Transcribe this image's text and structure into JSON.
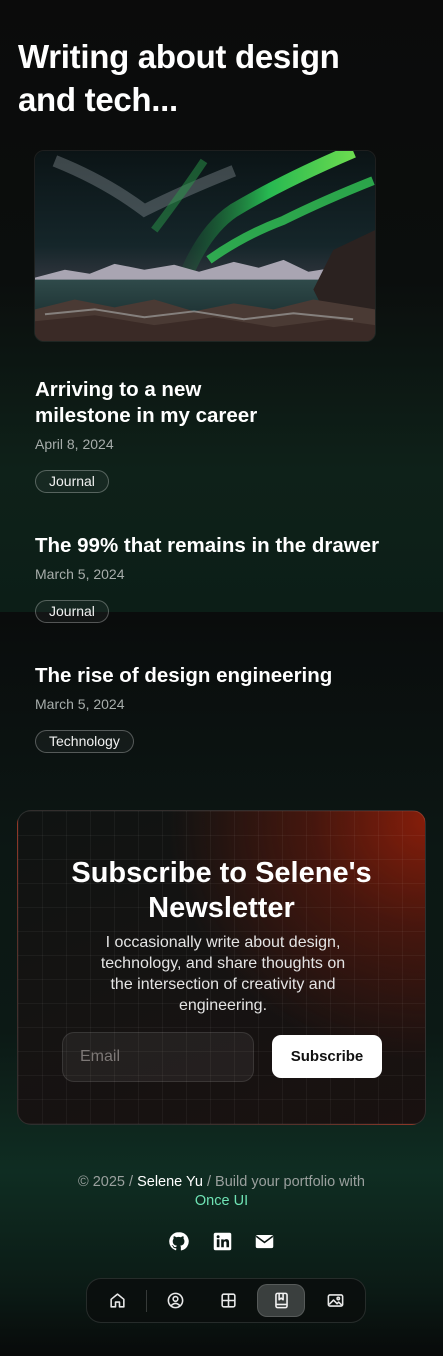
{
  "page": {
    "title": "Writing about design and tech..."
  },
  "posts": [
    {
      "title": "Arriving to a new milestone in my career",
      "date": "April 8, 2024",
      "tag": "Journal"
    },
    {
      "title": "The 99% that remains in the drawer",
      "date": "March 5, 2024",
      "tag": "Journal"
    },
    {
      "title": "The rise of design engineering",
      "date": "March 5, 2024",
      "tag": "Technology"
    }
  ],
  "newsletter": {
    "title": "Subscribe to Selene's Newsletter",
    "description": "I occasionally write about design, technology, and share thoughts on the intersection of creativity and engineering.",
    "email_placeholder": "Email",
    "email_value": "",
    "button_label": "Subscribe",
    "accent_color": "#8c1e0a"
  },
  "footer": {
    "copyright": "© 2025 /",
    "name": "Selene Yu",
    "build_text": "/ Build your portfolio with",
    "brand": "Once UI",
    "brand_color": "#6fe3b4",
    "social": [
      "github-icon",
      "linkedin-icon",
      "email-icon"
    ]
  },
  "nav": {
    "items": [
      "home-icon",
      "person-icon",
      "grid-icon",
      "book-icon",
      "gallery-icon"
    ],
    "active": "book-icon"
  }
}
